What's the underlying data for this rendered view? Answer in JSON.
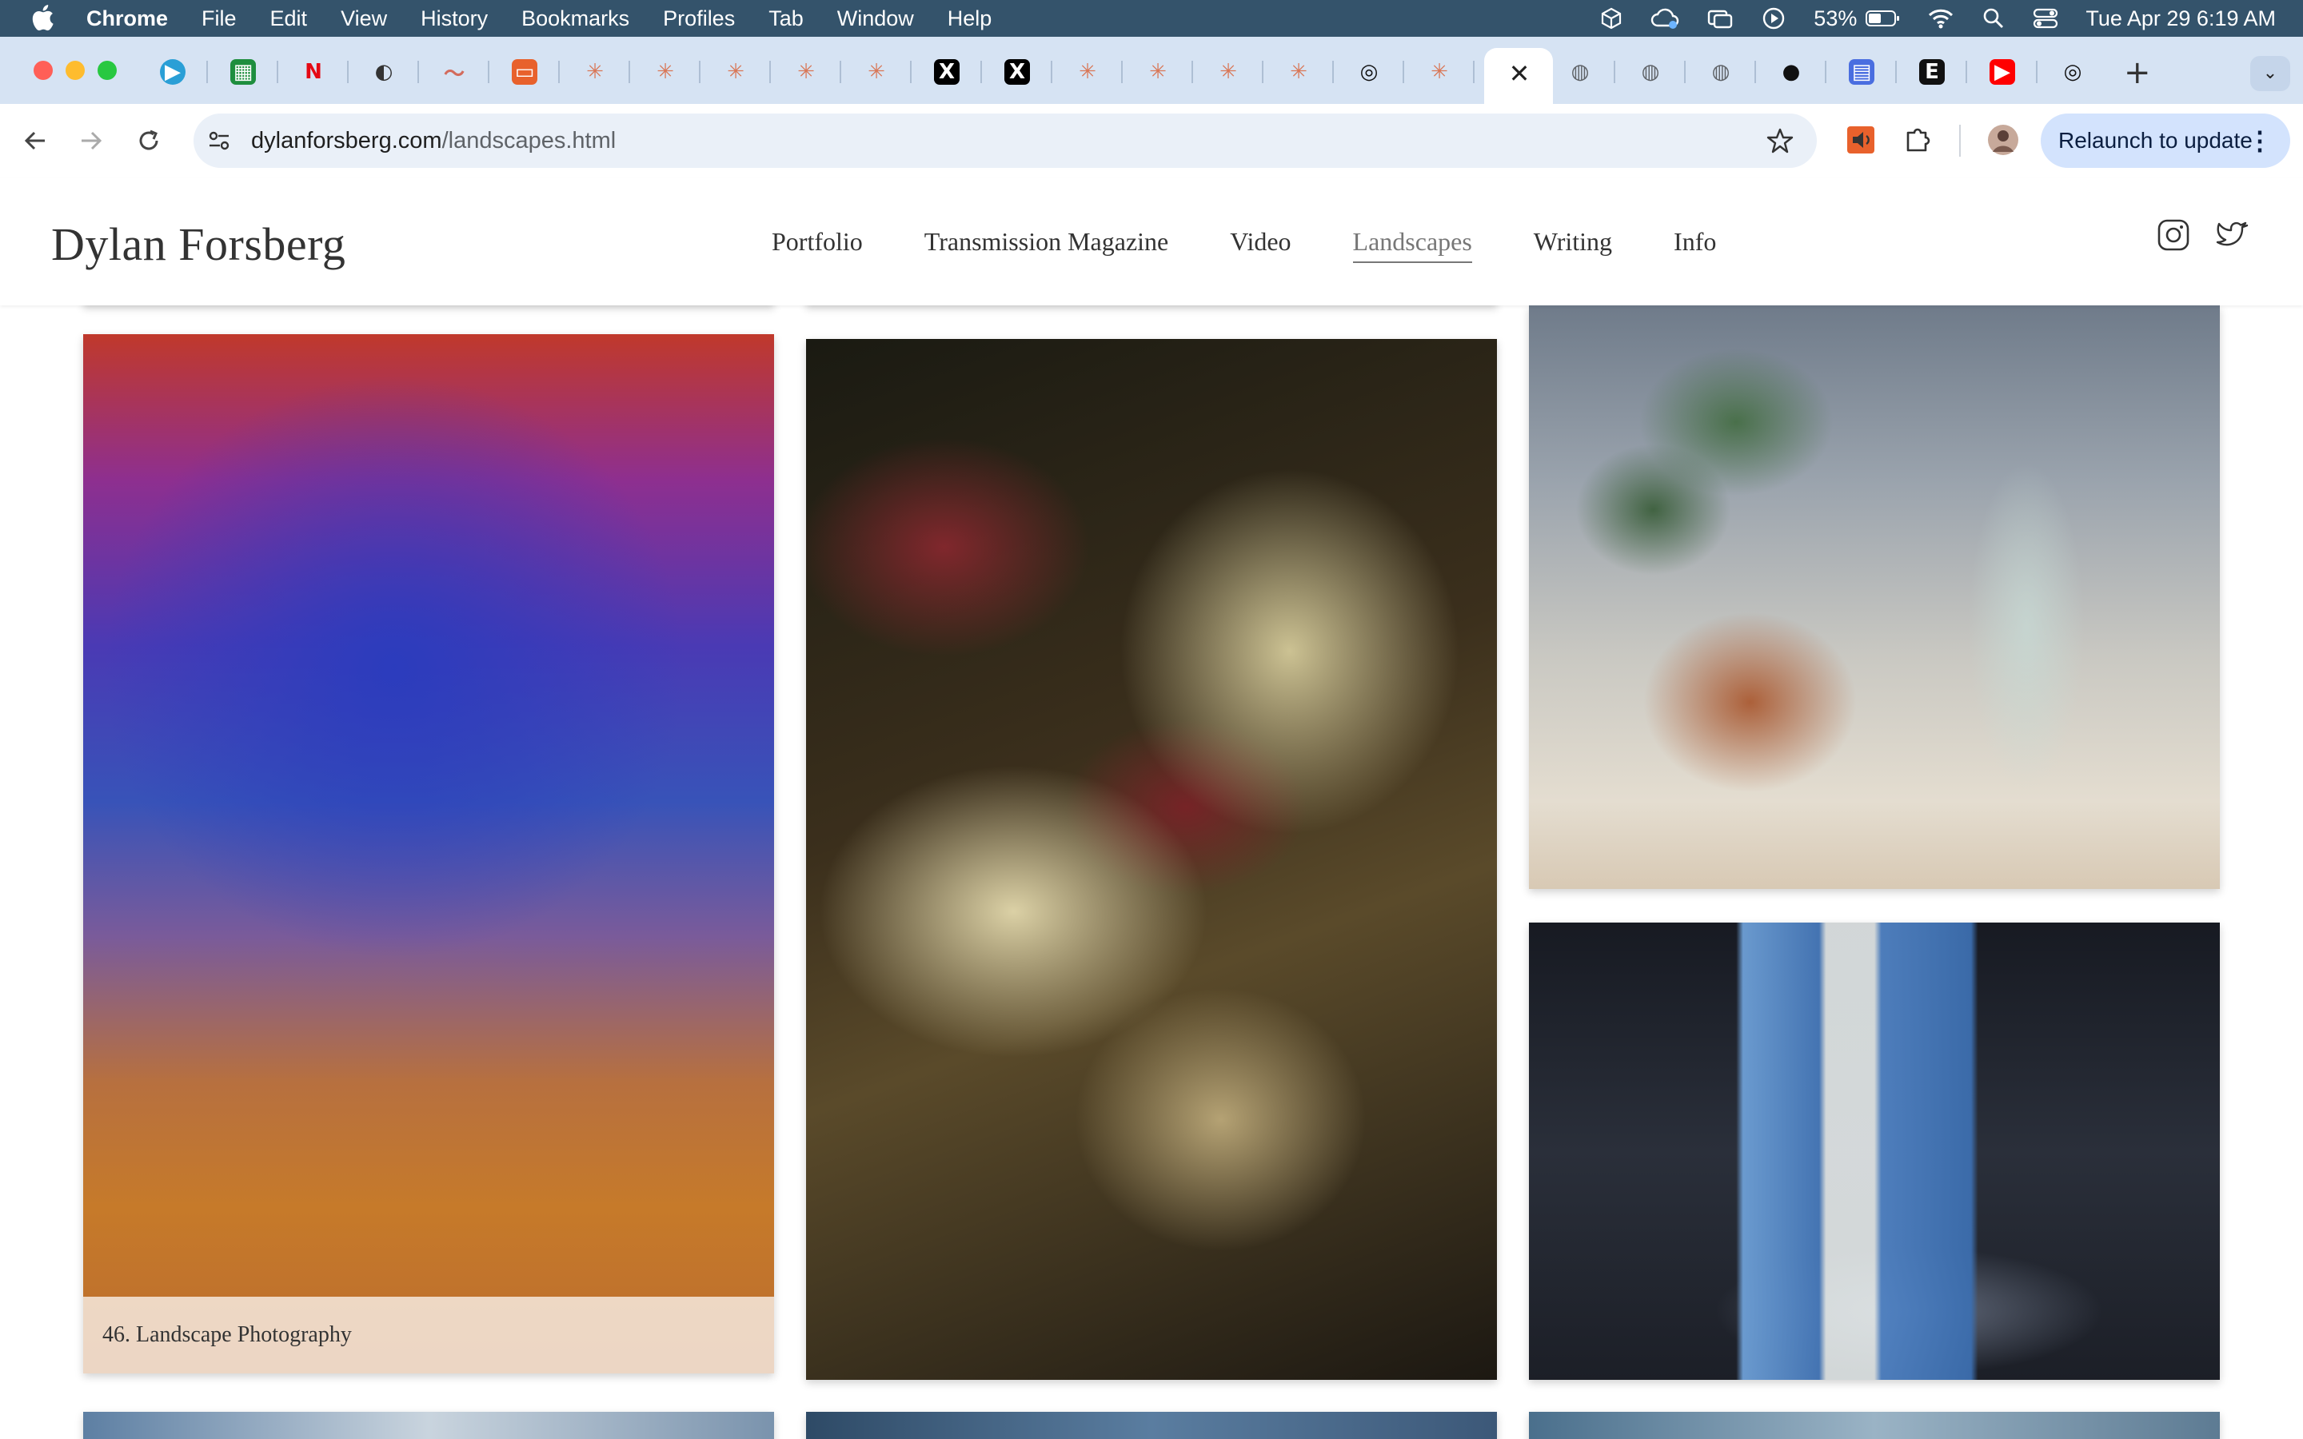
{
  "menubar": {
    "app_name": "Chrome",
    "menus": [
      "File",
      "Edit",
      "View",
      "History",
      "Bookmarks",
      "Profiles",
      "Tab",
      "Window",
      "Help"
    ],
    "battery": "53%",
    "datetime": "Tue Apr 29  6:19 AM"
  },
  "browser": {
    "url_domain": "dylanforsberg.com",
    "url_path": "/landscapes.html",
    "relaunch_label": "Relaunch to update",
    "tab_close_glyph": "✕",
    "new_tab_glyph": "+",
    "tab_search_glyph": "⌄",
    "tabs": [
      {
        "icon": "play-icon",
        "color": "#2a9fd6"
      },
      {
        "icon": "sheets-icon",
        "color": "#1e8e3e"
      },
      {
        "icon": "netflix-icon",
        "color": "#e50914"
      },
      {
        "icon": "perplexity-icon",
        "color": "#333333"
      },
      {
        "icon": "squiggle-icon",
        "color": "#d36b5c"
      },
      {
        "icon": "bookmark-app-icon",
        "color": "#e8612c"
      },
      {
        "icon": "claude-icon",
        "color": "#d97757"
      },
      {
        "icon": "claude-icon",
        "color": "#d97757"
      },
      {
        "icon": "claude-icon",
        "color": "#d97757"
      },
      {
        "icon": "claude-icon",
        "color": "#d97757"
      },
      {
        "icon": "claude-icon",
        "color": "#d97757"
      },
      {
        "icon": "x-icon",
        "color": "#000000"
      },
      {
        "icon": "x-icon",
        "color": "#000000"
      },
      {
        "icon": "claude-icon",
        "color": "#d97757"
      },
      {
        "icon": "claude-icon",
        "color": "#d97757"
      },
      {
        "icon": "claude-icon",
        "color": "#d97757"
      },
      {
        "icon": "claude-icon",
        "color": "#d97757"
      },
      {
        "icon": "openai-icon",
        "color": "#111111"
      },
      {
        "icon": "claude-icon",
        "color": "#d97757"
      },
      {
        "icon": "globe-icon",
        "color": "#5f6368"
      },
      {
        "icon": "globe-icon",
        "color": "#5f6368"
      },
      {
        "icon": "globe-icon",
        "color": "#5f6368"
      },
      {
        "icon": "github-icon",
        "color": "#111111"
      },
      {
        "icon": "dashboard-icon",
        "color": "#4a6ee0"
      },
      {
        "icon": "e-icon",
        "color": "#111111"
      },
      {
        "icon": "youtube-icon",
        "color": "#ff0000"
      },
      {
        "icon": "openai-icon",
        "color": "#111111"
      }
    ]
  },
  "site": {
    "title": "Dylan Forsberg",
    "nav": [
      "Portfolio",
      "Transmission Magazine",
      "Video",
      "Landscapes",
      "Writing",
      "Info"
    ],
    "current_nav": "Landscapes",
    "social": [
      "instagram-icon",
      "twitter-icon"
    ]
  },
  "gallery": {
    "photos": [
      {
        "name": "photo-color-gradient",
        "caption": "46. Landscape Photography"
      },
      {
        "name": "photo-leaf-closeup",
        "caption": ""
      },
      {
        "name": "photo-succulent-bottle",
        "caption": ""
      },
      {
        "name": "photo-bedroom-curtains",
        "caption": ""
      }
    ]
  }
}
